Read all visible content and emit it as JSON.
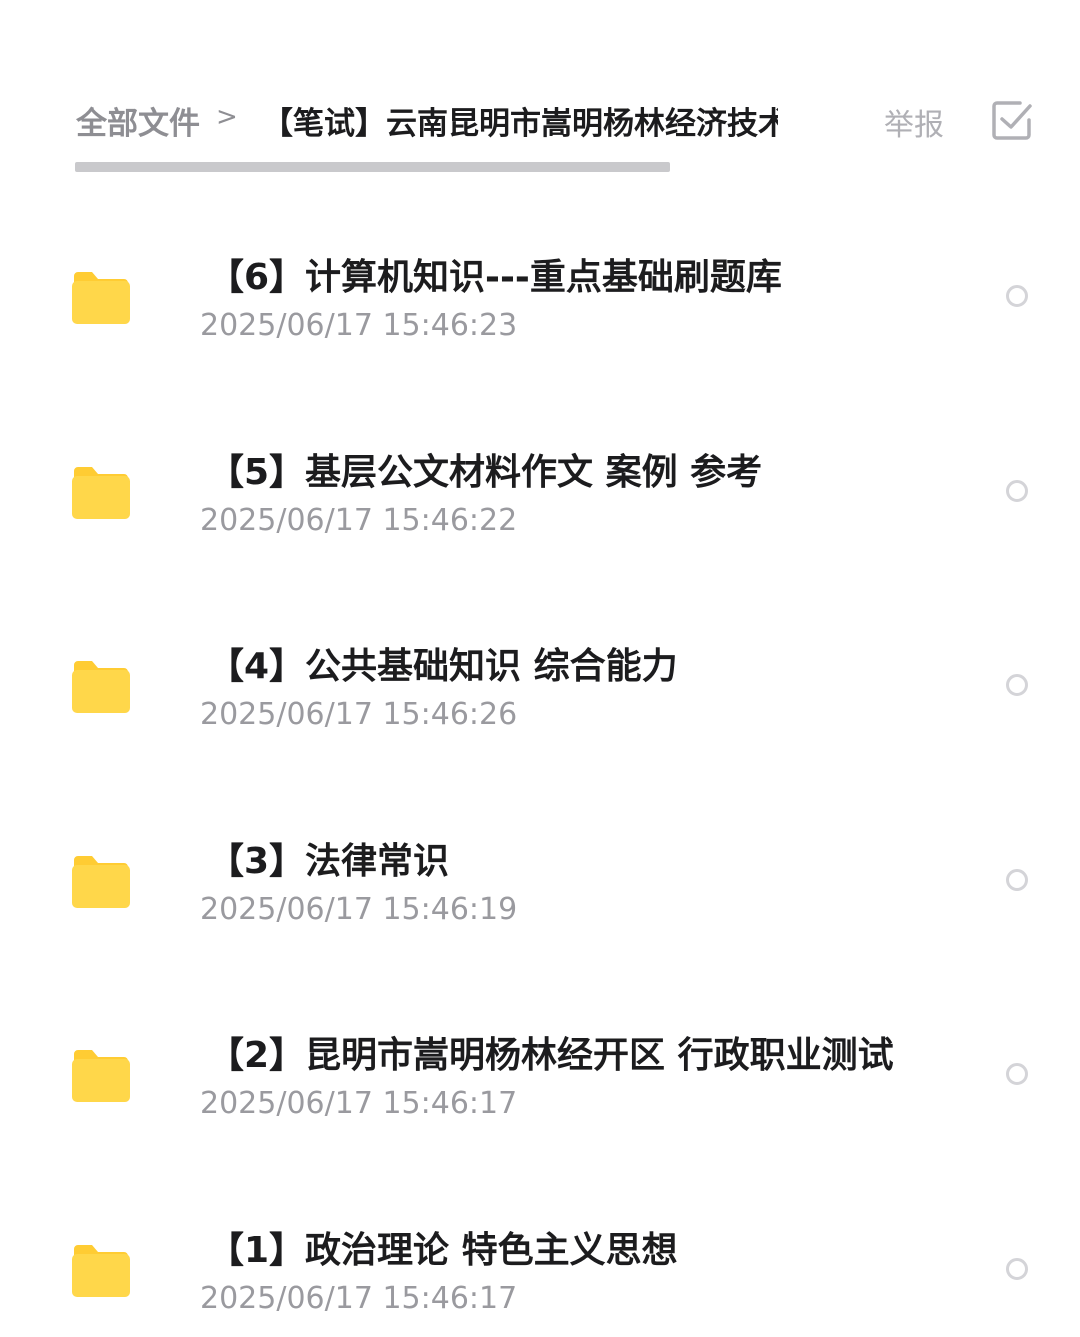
{
  "breadcrumb": {
    "root": "全部文件",
    "separator": ">",
    "current": "【笔试】云南昆明市嵩明杨林经济技术开发区"
  },
  "header": {
    "report_label": "举报",
    "select_icon": "checkbox-select-icon"
  },
  "colors": {
    "folder": "#FFD74A",
    "folder_tab": "#FFCC33",
    "title": "#1C1C1E",
    "muted": "#9A9A9F"
  },
  "files": [
    {
      "icon": "folder-icon",
      "name": "【6】计算机知识---重点基础刷题库",
      "time": "2025/06/17 15:46:23"
    },
    {
      "icon": "folder-icon",
      "name": "【5】基层公文材料作文 案例 参考",
      "time": "2025/06/17 15:46:22"
    },
    {
      "icon": "folder-icon",
      "name": "【4】公共基础知识 综合能力",
      "time": "2025/06/17 15:46:26"
    },
    {
      "icon": "folder-icon",
      "name": "【3】法律常识",
      "time": "2025/06/17 15:46:19"
    },
    {
      "icon": "folder-icon",
      "name": "【2】昆明市嵩明杨林经开区 行政职业测试",
      "time": "2025/06/17 15:46:17"
    },
    {
      "icon": "folder-icon",
      "name": "【1】政治理论 特色主义思想",
      "time": "2025/06/17 15:46:17"
    }
  ]
}
